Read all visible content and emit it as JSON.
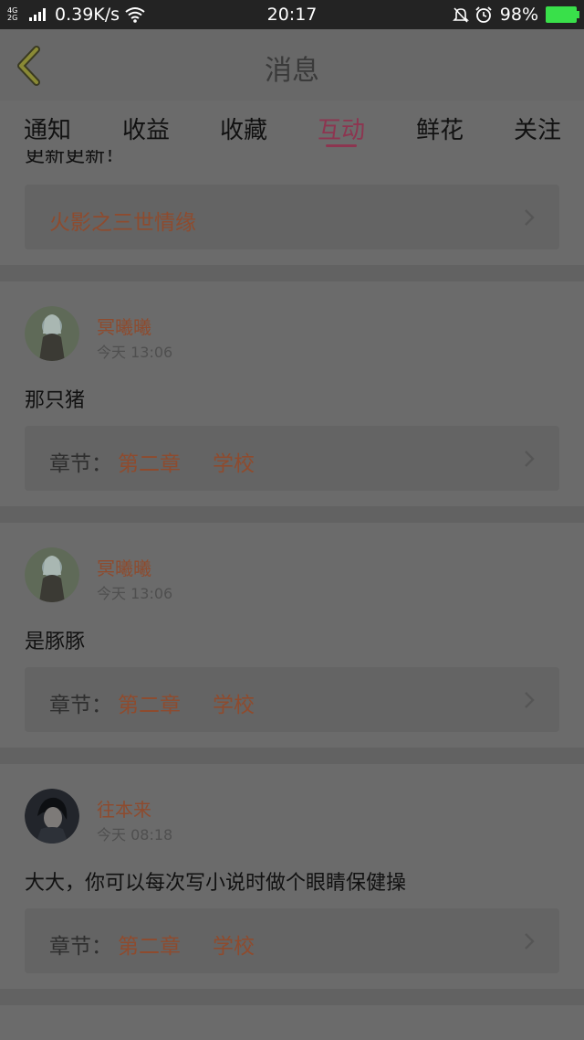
{
  "status_bar": {
    "network": "4G 2G",
    "speed": "0.39K/s",
    "time": "20:17",
    "battery": "98%",
    "icons": [
      "signal-icon",
      "wifi-icon",
      "mute-icon",
      "alarm-icon",
      "battery-icon"
    ]
  },
  "header": {
    "title": "消息",
    "back_icon": "chevron-left-icon"
  },
  "tabs": [
    {
      "label": "通知",
      "active": false
    },
    {
      "label": "收益",
      "active": false
    },
    {
      "label": "收藏",
      "active": false
    },
    {
      "label": "互动",
      "active": true
    },
    {
      "label": "鲜花",
      "active": false
    },
    {
      "label": "关注",
      "active": false
    }
  ],
  "colors": {
    "accent": "#8d3550",
    "name_color": "#8e4b2e",
    "background": "#6b6b6b"
  },
  "first_item": {
    "truncated_text": "更新更新！",
    "book_title": "火影之三世情缘"
  },
  "messages": [
    {
      "username": "冥曦曦",
      "time": "今天 13:06",
      "text": "那只猪",
      "ref_label": "章节：",
      "ref_chapter": "第二章",
      "ref_title": "学校"
    },
    {
      "username": "冥曦曦",
      "time": "今天 13:06",
      "text": "是豚豚",
      "ref_label": "章节：",
      "ref_chapter": "第二章",
      "ref_title": "学校"
    },
    {
      "username": "往本来",
      "time": "今天 08:18",
      "text": "大大，你可以每次写小说时做个眼睛保健操",
      "ref_label": "章节：",
      "ref_chapter": "第二章",
      "ref_title": "学校"
    }
  ]
}
